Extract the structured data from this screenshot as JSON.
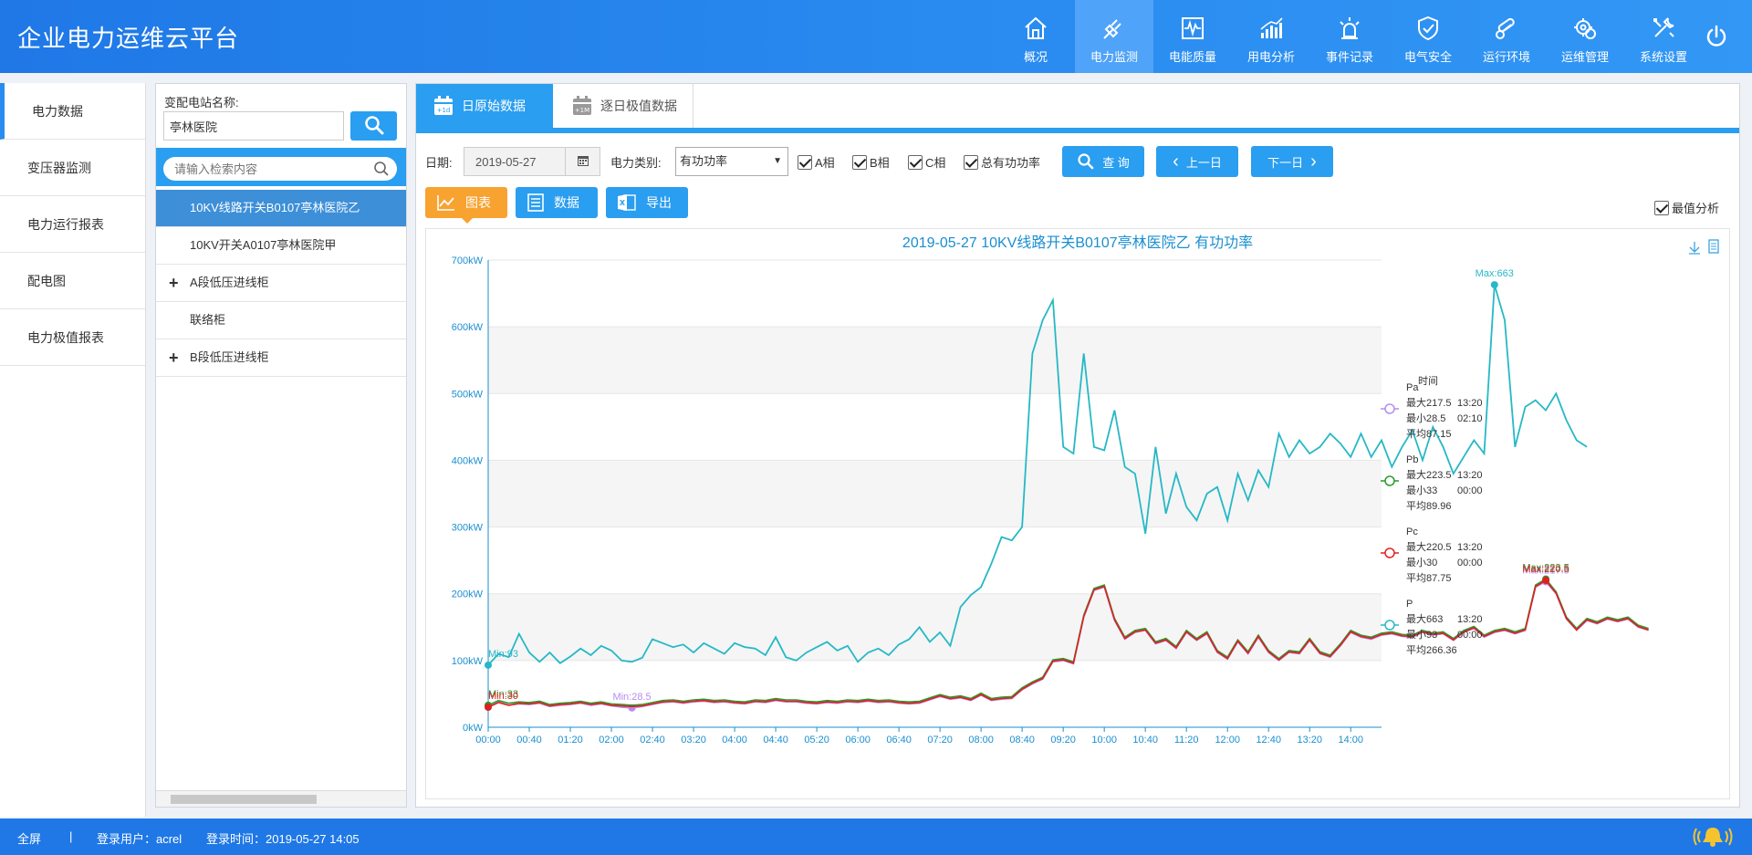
{
  "app": {
    "title": "企业电力运维云平台"
  },
  "nav": [
    {
      "label": "概况",
      "icon": "home-icon"
    },
    {
      "label": "电力监测",
      "icon": "plug-icon",
      "active": true
    },
    {
      "label": "电能质量",
      "icon": "waveform-icon"
    },
    {
      "label": "用电分析",
      "icon": "bar-chart-icon"
    },
    {
      "label": "事件记录",
      "icon": "alarm-light-icon"
    },
    {
      "label": "电气安全",
      "icon": "shield-check-icon"
    },
    {
      "label": "运行环境",
      "icon": "thermometer-icon"
    },
    {
      "label": "运维管理",
      "icon": "gear-group-icon"
    },
    {
      "label": "系统设置",
      "icon": "wrench-icon"
    }
  ],
  "left_menu": [
    "电力数据",
    "变压器监测",
    "电力运行报表",
    "配电图",
    "电力极值报表"
  ],
  "station": {
    "label": "变配电站名称:",
    "value": "亭林医院",
    "search_placeholder": "请输入检索内容"
  },
  "tree": [
    {
      "label": "10KV线路开关B0107亭林医院乙",
      "selected": true,
      "expand": false
    },
    {
      "label": "10KV开关A0107亭林医院甲",
      "selected": false,
      "expand": false
    },
    {
      "label": "A段低压进线柜",
      "selected": false,
      "expand": true
    },
    {
      "label": "联络柜",
      "selected": false,
      "expand": false
    },
    {
      "label": "B段低压进线柜",
      "selected": false,
      "expand": true
    }
  ],
  "tabs": {
    "daily": "日原始数据",
    "extreme": "逐日极值数据"
  },
  "toolbar": {
    "date_label": "日期:",
    "date_value": "2019-05-27",
    "type_label": "电力类别:",
    "type_value": "有功功率",
    "cb_a": "A相",
    "cb_b": "B相",
    "cb_c": "C相",
    "cb_total": "总有功功率",
    "query": "查 询",
    "prev": "上一日",
    "next": "下一日"
  },
  "view": {
    "chart": "图表",
    "data": "数据",
    "export": "导出",
    "extreme_analysis": "最值分析"
  },
  "chart_data": {
    "type": "line",
    "title": "2019-05-27  10KV线路开关B0107亭林医院乙  有功功率",
    "y_ticks": [
      "0kW",
      "100kW",
      "200kW",
      "300kW",
      "400kW",
      "500kW",
      "600kW",
      "700kW"
    ],
    "ylim": [
      0,
      700
    ],
    "x_ticks": [
      "00:00",
      "00:40",
      "01:20",
      "02:00",
      "02:40",
      "03:20",
      "04:00",
      "04:40",
      "05:20",
      "06:00",
      "06:40",
      "07:20",
      "08:00",
      "08:40",
      "09:20",
      "10:00",
      "10:40",
      "11:20",
      "12:00",
      "12:40",
      "13:20",
      "14:00"
    ],
    "x_step_minutes": 10,
    "series": [
      {
        "name": "Pa",
        "color": "#b58cf0",
        "max": "最大217.5",
        "max_time": "13:20",
        "min": "最小28.5",
        "min_time": "02:10",
        "avg": "平均87.15",
        "min_label": "Min:28.5",
        "max_label": "Max:217.5",
        "values": [
          30,
          38,
          33,
          35,
          34,
          36,
          31,
          33,
          34,
          36,
          33,
          35,
          32,
          30,
          29,
          31,
          34,
          37,
          38,
          36,
          38,
          39,
          37,
          38,
          36,
          35,
          38,
          37,
          40,
          38,
          38,
          36,
          35,
          37,
          36,
          38,
          37,
          39,
          37,
          38,
          36,
          35,
          36,
          41,
          46,
          42,
          44,
          40,
          48,
          40,
          42,
          43,
          56,
          65,
          72,
          98,
          100,
          95,
          165,
          205,
          210,
          160,
          132,
          142,
          145,
          125,
          130,
          118,
          142,
          130,
          140,
          112,
          102,
          128,
          110,
          135,
          112,
          100,
          112,
          110,
          130,
          110,
          105,
          122,
          142,
          135,
          132,
          138,
          140,
          136,
          135,
          142,
          138,
          140,
          130,
          142,
          148,
          135,
          142,
          145,
          140,
          145,
          210,
          218,
          200,
          162,
          145,
          160,
          155,
          162,
          158,
          162,
          150,
          145
        ]
      },
      {
        "name": "Pb",
        "color": "#2a9a2a",
        "max": "最大223.5",
        "max_time": "13:20",
        "min": "最小33",
        "min_time": "00:00",
        "avg": "平均89.96",
        "min_label": "Min:33",
        "max_label": "Max:223.5",
        "values": [
          33,
          40,
          36,
          38,
          37,
          39,
          34,
          36,
          37,
          39,
          36,
          38,
          35,
          34,
          33,
          34,
          37,
          40,
          41,
          39,
          41,
          42,
          40,
          41,
          39,
          38,
          41,
          40,
          43,
          41,
          41,
          39,
          38,
          40,
          39,
          41,
          40,
          42,
          40,
          41,
          39,
          38,
          39,
          44,
          49,
          45,
          47,
          43,
          51,
          43,
          45,
          46,
          59,
          68,
          75,
          101,
          103,
          98,
          168,
          208,
          213,
          163,
          135,
          145,
          148,
          128,
          133,
          121,
          145,
          133,
          143,
          115,
          105,
          131,
          113,
          138,
          115,
          103,
          115,
          113,
          133,
          113,
          108,
          125,
          145,
          138,
          135,
          141,
          143,
          139,
          138,
          145,
          141,
          143,
          133,
          145,
          151,
          138,
          145,
          148,
          143,
          148,
          213,
          222,
          203,
          165,
          148,
          163,
          158,
          165,
          161,
          165,
          153,
          148
        ]
      },
      {
        "name": "Pc",
        "color": "#e02020",
        "max": "最大220.5",
        "max_time": "13:20",
        "min": "最小30",
        "min_time": "00:00",
        "avg": "平均87.75",
        "min_label": "Min:30",
        "max_label": "Max:220.5",
        "values": [
          30,
          37,
          33,
          36,
          35,
          37,
          32,
          34,
          35,
          37,
          34,
          36,
          33,
          32,
          31,
          32,
          35,
          38,
          39,
          37,
          39,
          40,
          38,
          39,
          37,
          36,
          39,
          38,
          41,
          39,
          39,
          37,
          36,
          38,
          37,
          39,
          38,
          40,
          38,
          39,
          37,
          36,
          37,
          42,
          47,
          43,
          45,
          41,
          49,
          41,
          43,
          44,
          57,
          66,
          73,
          99,
          101,
          96,
          166,
          206,
          211,
          161,
          133,
          143,
          146,
          126,
          131,
          119,
          143,
          131,
          141,
          113,
          103,
          129,
          111,
          136,
          113,
          101,
          113,
          111,
          131,
          111,
          106,
          123,
          143,
          136,
          133,
          139,
          141,
          137,
          136,
          143,
          139,
          141,
          131,
          143,
          149,
          136,
          143,
          146,
          141,
          146,
          211,
          220,
          201,
          163,
          146,
          161,
          156,
          163,
          159,
          163,
          151,
          146
        ]
      },
      {
        "name": "P",
        "color": "#26b8c6",
        "max": "最大663",
        "max_time": "13:20",
        "min": "最小93",
        "min_time": "00:00",
        "avg": "平均266.36",
        "min_label": "Min:93",
        "max_label": "Max:663",
        "values": [
          93,
          110,
          105,
          140,
          112,
          98,
          112,
          96,
          106,
          118,
          108,
          122,
          115,
          100,
          98,
          104,
          132,
          126,
          120,
          124,
          112,
          126,
          118,
          110,
          126,
          120,
          118,
          108,
          135,
          105,
          100,
          112,
          120,
          128,
          115,
          122,
          98,
          112,
          118,
          108,
          124,
          132,
          150,
          128,
          142,
          122,
          180,
          198,
          210,
          245,
          285,
          280,
          300,
          560,
          610,
          640,
          420,
          410,
          560,
          420,
          415,
          475,
          390,
          380,
          290,
          420,
          320,
          380,
          330,
          310,
          350,
          360,
          310,
          380,
          340,
          385,
          360,
          440,
          405,
          430,
          410,
          420,
          440,
          425,
          405,
          440,
          405,
          430,
          390,
          420,
          445,
          400,
          450,
          420,
          380,
          405,
          430,
          410,
          663,
          610,
          420,
          480,
          490,
          475,
          500,
          460,
          430,
          420
        ]
      }
    ]
  },
  "footer": {
    "fullscreen": "全屏",
    "sep": "|",
    "user": "登录用户：acrel",
    "login_time": "登录时间：2019-05-27 14:05"
  }
}
